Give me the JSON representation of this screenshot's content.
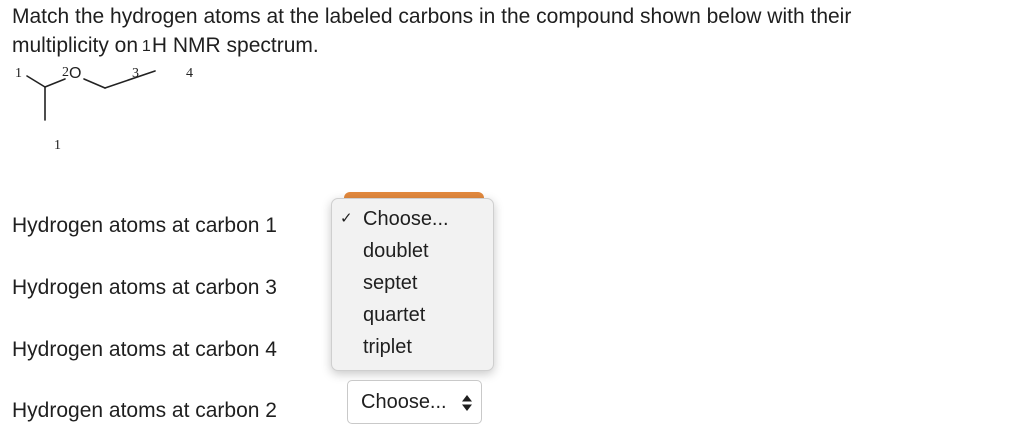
{
  "question": {
    "line1": "Match the hydrogen atoms at the labeled carbons in the compound shown below with their",
    "line2_before": "multiplicity on",
    "superscript": "1",
    "line2_after": "H NMR spectrum."
  },
  "molecule": {
    "labels": [
      "1",
      "2",
      "O",
      "3",
      "4",
      "1"
    ]
  },
  "rows": [
    {
      "label": "Hydrogen atoms at carbon 1",
      "value": "Choose...",
      "state": "open"
    },
    {
      "label": "Hydrogen atoms at carbon 3"
    },
    {
      "label": "Hydrogen atoms at carbon 4"
    },
    {
      "label": "Hydrogen atoms at carbon 2",
      "value": "Choose..."
    }
  ],
  "dropdown": {
    "checkmark": "✓",
    "selected": "Choose...",
    "options": [
      "Choose...",
      "doublet",
      "septet",
      "quartet",
      "triplet"
    ]
  },
  "colors": {
    "select_accent": "#e2893e",
    "menu_background": "#f2f2f2"
  },
  "icons": [
    "check-icon",
    "up-down-arrows-icon"
  ]
}
